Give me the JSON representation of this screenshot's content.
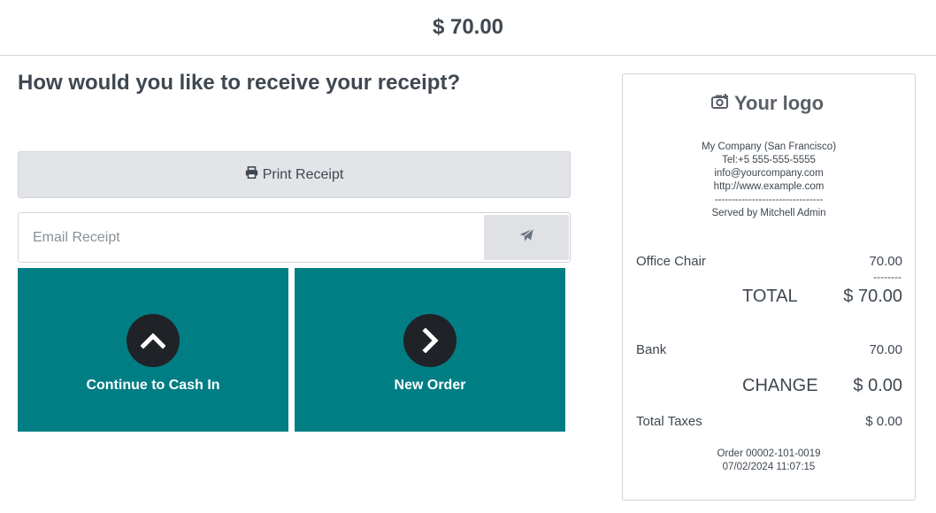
{
  "header": {
    "total": "$ 70.00"
  },
  "main": {
    "question": "How would you like to receive your receipt?",
    "print_label": "Print Receipt",
    "email_placeholder": "Email Receipt",
    "actions": [
      {
        "label": "Continue to Cash In",
        "icon": "chevron-up-icon"
      },
      {
        "label": "New Order",
        "icon": "chevron-right-icon"
      }
    ]
  },
  "receipt": {
    "logo_text": "Your logo",
    "company": {
      "name": "My Company (San Francisco)",
      "phone": "Tel:+5 555-555-5555",
      "email": "info@yourcompany.com",
      "website": "http://www.example.com",
      "separator": "--------------------------------",
      "served_by": "Served by Mitchell Admin"
    },
    "lines": [
      {
        "product": "Office Chair",
        "price": "70.00"
      }
    ],
    "dashes": "--------",
    "total_label": "TOTAL",
    "total_value": "$ 70.00",
    "payment": {
      "method": "Bank",
      "amount": "70.00"
    },
    "change_label": "CHANGE",
    "change_value": "$ 0.00",
    "taxes_label": "Total Taxes",
    "taxes_value": "$ 0.00",
    "order_ref": "Order 00002-101-0019",
    "order_date": "07/02/2024 11:07:15"
  },
  "colors": {
    "accent": "#017e84",
    "circle": "#1f2227",
    "button_gray": "#e2e4e8",
    "text": "#3f4750"
  }
}
